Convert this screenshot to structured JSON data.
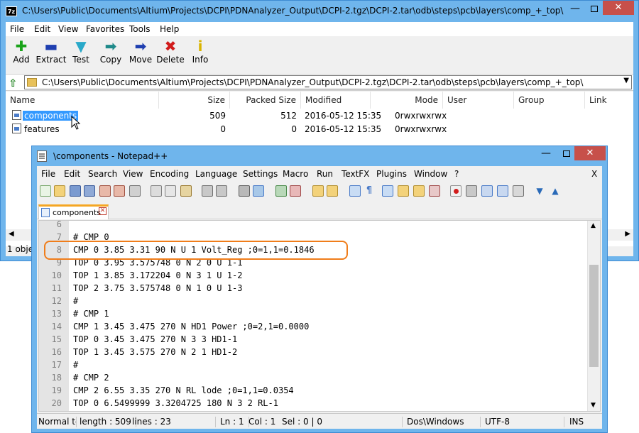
{
  "sevenzip": {
    "title": "C:\\Users\\Public\\Documents\\Altium\\Projects\\DCPI\\PDNAnalyzer_Output\\DCPI-2.tgz\\DCPI-2.tar\\odb\\steps\\pcb\\layers\\comp_+_top\\",
    "app_icon": "7z",
    "menu": [
      "File",
      "Edit",
      "View",
      "Favorites",
      "Tools",
      "Help"
    ],
    "toolbar": [
      {
        "label": "Add",
        "icon": "plus-icon",
        "color": "#1aa31a"
      },
      {
        "label": "Extract",
        "icon": "minus-icon",
        "color": "#1f3fb0"
      },
      {
        "label": "Test",
        "icon": "check-icon",
        "color": "#2aa9c9"
      },
      {
        "label": "Copy",
        "icon": "copy-arrow-icon",
        "color": "#1f8a8a"
      },
      {
        "label": "Move",
        "icon": "move-arrow-icon",
        "color": "#1f3fb0"
      },
      {
        "label": "Delete",
        "icon": "x-icon",
        "color": "#d11b1b"
      },
      {
        "label": "Info",
        "icon": "info-icon",
        "color": "#d9b400"
      }
    ],
    "address": "C:\\Users\\Public\\Documents\\Altium\\Projects\\DCPI\\PDNAnalyzer_Output\\DCPI-2.tgz\\DCPI-2.tar\\odb\\steps\\pcb\\layers\\comp_+_top\\",
    "columns": [
      "Name",
      "Size",
      "Packed Size",
      "Modified",
      "Mode",
      "User",
      "Group",
      "Link"
    ],
    "files": [
      {
        "name": "components",
        "size": "509",
        "packed": "512",
        "modified": "2016-05-12 15:35",
        "mode": "0rwxrwxrwx"
      },
      {
        "name": "features",
        "size": "0",
        "packed": "0",
        "modified": "2016-05-12 15:35",
        "mode": "0rwxrwxrwx"
      }
    ],
    "status": "1 obje"
  },
  "notepad": {
    "title": "\\components - Notepad++",
    "menu": [
      "File",
      "Edit",
      "Search",
      "View",
      "Encoding",
      "Language",
      "Settings",
      "Macro",
      "Run",
      "TextFX",
      "Plugins",
      "Window",
      "?"
    ],
    "close_x": "X",
    "tab": "components",
    "lines": [
      {
        "n": "6",
        "t": ""
      },
      {
        "n": "7",
        "t": "# CMP 0"
      },
      {
        "n": "8",
        "t": "CMP 0 3.85 3.31 90 N U 1 Volt_Reg ;0=1,1=0.1846"
      },
      {
        "n": "9",
        "t": "TOP 0 3.95 3.575748 0 N 2 0 U 1-1"
      },
      {
        "n": "10",
        "t": "TOP 1 3.85 3.172204 0 N 3 1 U 1-2"
      },
      {
        "n": "11",
        "t": "TOP 2 3.75 3.575748 0 N 1 0 U 1-3"
      },
      {
        "n": "12",
        "t": "#"
      },
      {
        "n": "13",
        "t": "# CMP 1"
      },
      {
        "n": "14",
        "t": "CMP 1 3.45 3.475 270 N HD1 Power ;0=2,1=0.0000"
      },
      {
        "n": "15",
        "t": "TOP 0 3.45 3.475 270 N 3 3 HD1-1"
      },
      {
        "n": "16",
        "t": "TOP 1 3.45 3.575 270 N 2 1 HD1-2"
      },
      {
        "n": "17",
        "t": "#"
      },
      {
        "n": "18",
        "t": "# CMP 2"
      },
      {
        "n": "19",
        "t": "CMP 2 6.55 3.35 270 N RL lode ;0=1,1=0.0354"
      },
      {
        "n": "20",
        "t": "TOP 0 6.5499999 3.3204725 180 N 3 2 RL-1"
      }
    ],
    "status": {
      "type": "Normal te",
      "length": "length : 509",
      "lines": "lines : 23",
      "ln": "Ln : 1",
      "col": "Col : 1",
      "sel": "Sel : 0 | 0",
      "eol": "Dos\\Windows",
      "enc": "UTF-8",
      "ins": "INS"
    }
  },
  "colors": {
    "title_bar": "#6fb5ec",
    "close_button": "#c7504a",
    "selection": "#3399ff",
    "highlight_outline": "#f07d1a"
  }
}
